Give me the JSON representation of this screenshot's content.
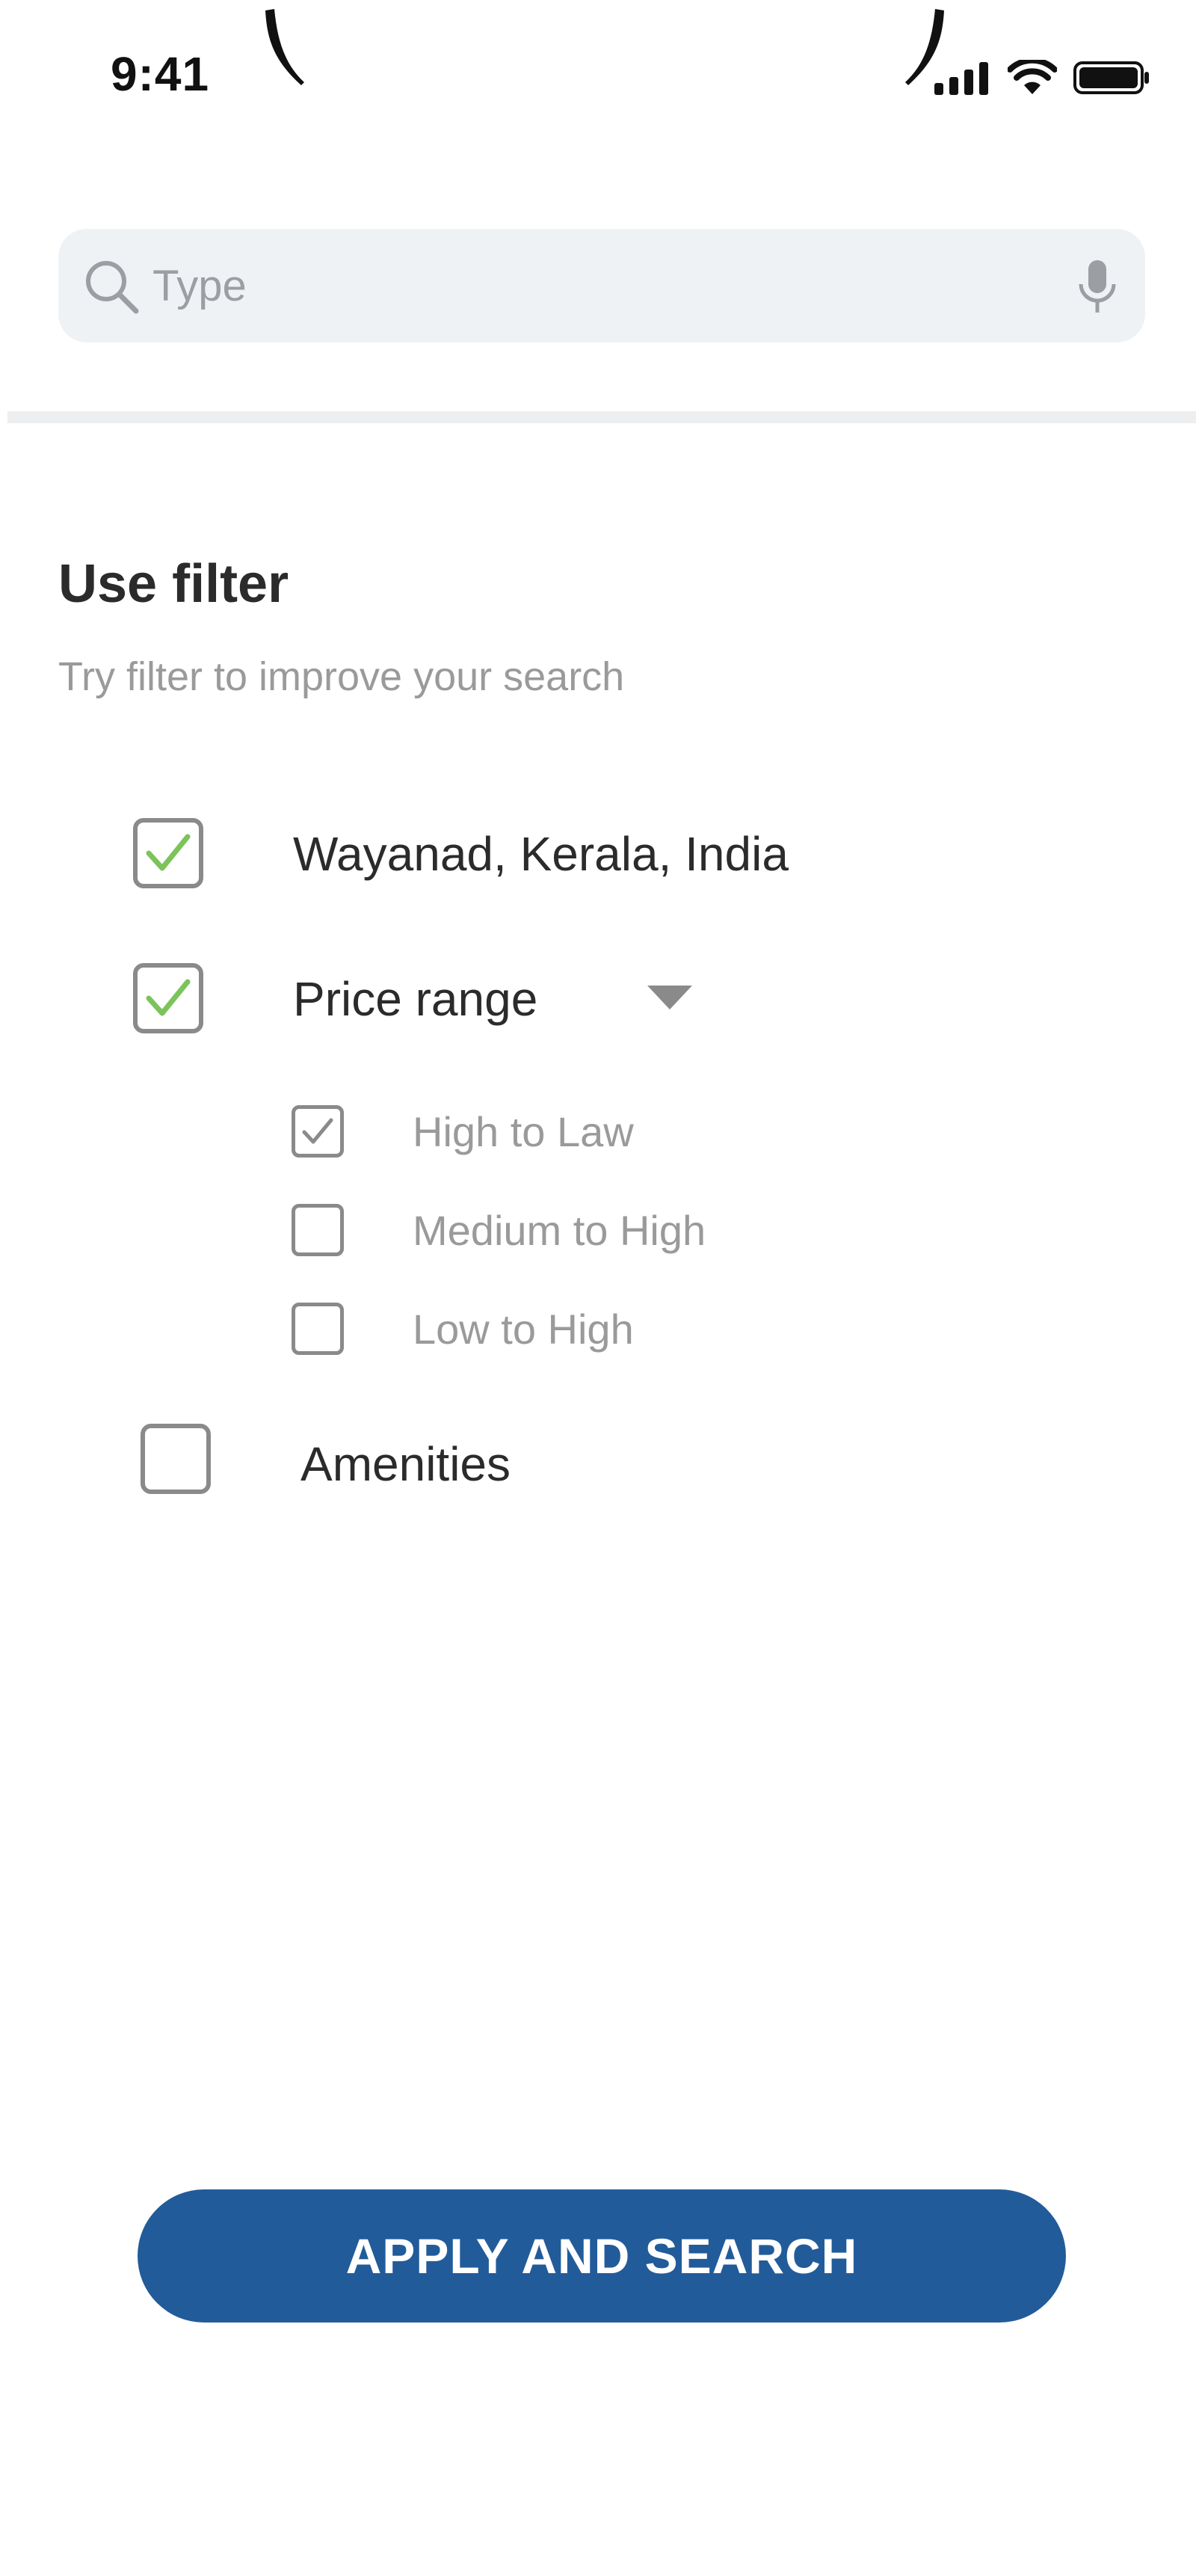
{
  "status_bar": {
    "time": "9:41",
    "icons": [
      "signal-icon",
      "wifi-icon",
      "battery-icon"
    ]
  },
  "search": {
    "placeholder": "Type",
    "value": ""
  },
  "filter": {
    "title": "Use filter",
    "subtitle": "Try filter to improve your search",
    "options": [
      {
        "label": "Wayanad, Kerala, India",
        "checked": true
      },
      {
        "label": "Price range",
        "checked": true,
        "expanded": true,
        "sub_options": [
          {
            "label": "High to Law",
            "checked": true
          },
          {
            "label": "Medium to High",
            "checked": false
          },
          {
            "label": "Low to High",
            "checked": false
          }
        ]
      },
      {
        "label": "Amenities",
        "checked": false
      }
    ]
  },
  "apply_button": {
    "label": "APPLY AND SEARCH"
  },
  "colors": {
    "accent": "#225b9a",
    "check_green": "#7cc35b",
    "search_bg": "#eff2f5"
  }
}
